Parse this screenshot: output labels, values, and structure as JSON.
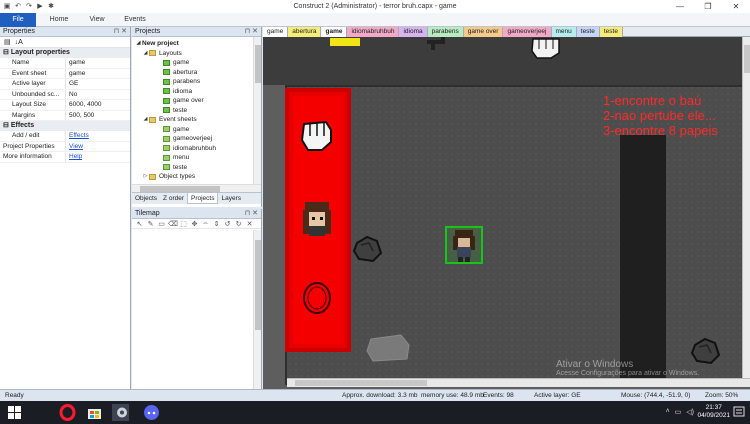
{
  "window": {
    "title": "Construct 2 (Administrator) - terror bruh.capx - game",
    "quick_access": [
      "disk-icon",
      "undo-icon",
      "redo-icon",
      "play-icon",
      "bug-icon"
    ],
    "controls": [
      "—",
      "❐",
      "✕"
    ]
  },
  "ribbon": {
    "file": "File",
    "tabs": [
      "Home",
      "View",
      "Events"
    ]
  },
  "properties": {
    "header": "Properties",
    "layout_section": "Layout properties",
    "rows": [
      {
        "k": "Name",
        "v": "game"
      },
      {
        "k": "Event sheet",
        "v": "game"
      },
      {
        "k": "Active layer",
        "v": "GE"
      },
      {
        "k": "Unbounded sc...",
        "v": "No"
      },
      {
        "k": "Layout Size",
        "v": "6000, 4000"
      },
      {
        "k": "Margins",
        "v": "500, 500"
      }
    ],
    "effects_section": "Effects",
    "effects_row": {
      "k": "Add / edit",
      "v": "Effects"
    },
    "project_row": {
      "k": "Project Properties",
      "v": "View"
    },
    "more_row": {
      "k": "More information",
      "v": "Help"
    }
  },
  "projects": {
    "header": "Projects",
    "root": "New project",
    "layouts_folder": "Layouts",
    "layouts": [
      "game",
      "abertura",
      "parabens",
      "idioma",
      "game over",
      "teste"
    ],
    "sheets_folder": "Event sheets",
    "sheets": [
      "game",
      "gameoverjeej",
      "idiomabruhbuh",
      "menu",
      "teste"
    ],
    "object_types": "Object types",
    "bottom_tabs": [
      "Objects",
      "Z order",
      "Projects",
      "Layers"
    ],
    "active_tab": "Projects"
  },
  "tilemap": {
    "header": "Tilemap",
    "tools": [
      "↖",
      "✎",
      "▭",
      "⌫",
      "⬚",
      "✥",
      "⇔",
      "⇕",
      "↺",
      "↻",
      "✕"
    ]
  },
  "layout_tabs": [
    {
      "label": "game",
      "color": "#ffffff"
    },
    {
      "label": "abertura",
      "color": "#f6ec7a"
    },
    {
      "label": "game",
      "color": "#ffffff",
      "active": true
    },
    {
      "label": "idiomabruhbuh",
      "color": "#f3a8c6"
    },
    {
      "label": "idioma",
      "color": "#d6b4ee"
    },
    {
      "label": "parabens",
      "color": "#b7ecc0"
    },
    {
      "label": "game over",
      "color": "#f6c98a"
    },
    {
      "label": "gameoverjeej",
      "color": "#f3a8c6"
    },
    {
      "label": "menu",
      "color": "#b7ecec"
    },
    {
      "label": "teste",
      "color": "#c7d6f5"
    },
    {
      "label": "teste",
      "color": "#f6ec7a"
    }
  ],
  "canvas": {
    "instructions": [
      "1-encontre o baú",
      "2-nao pertube ele...",
      "3-encontre 8 papeis"
    ],
    "watermark_title": "Ativar o Windows",
    "watermark_sub": "Acesse Configurações para ativar o Windows."
  },
  "status": {
    "ready": "Ready",
    "download": "Approx. download: 3.3 mb",
    "memory": "memory use: 48.9 mb",
    "events": "Events: 98",
    "layer": "Active layer: GE",
    "mouse": "Mouse: (744.4, -51.9, 0)",
    "zoom": "Zoom: 50%"
  },
  "taskbar": {
    "time": "21:37",
    "date": "04/09/2021"
  }
}
